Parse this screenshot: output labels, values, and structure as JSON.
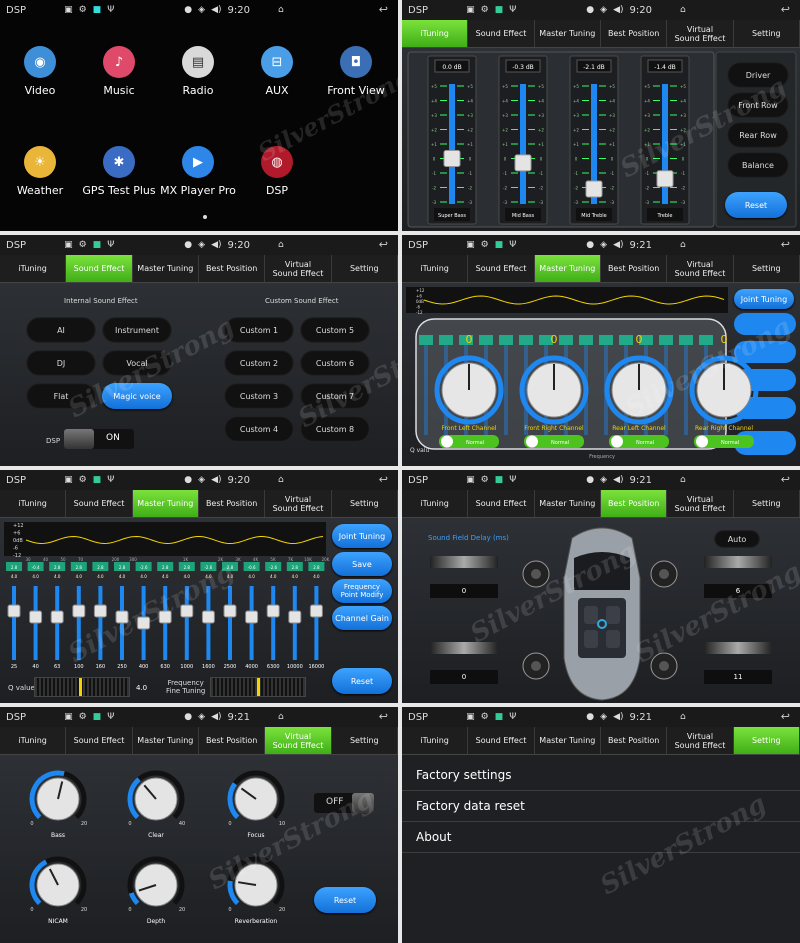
{
  "status": {
    "app": "DSP",
    "time_a": "9:20",
    "time_b": "9:21"
  },
  "watermark": "SilverStrong",
  "tabs": [
    "iTuning",
    "Sound Effect",
    "Master Tuning",
    "Best Position",
    "Virtual\nSound Effect",
    "Setting"
  ],
  "home": {
    "apps": [
      {
        "label": "Video",
        "icon": "video-icon",
        "color": "#3f8fd8"
      },
      {
        "label": "Music",
        "icon": "music-icon",
        "color": "#e04a6a"
      },
      {
        "label": "Radio",
        "icon": "radio-icon",
        "color": "#d9d9d9"
      },
      {
        "label": "AUX",
        "icon": "aux-icon",
        "color": "#4a9ee8"
      },
      {
        "label": "Front View",
        "icon": "camera-icon",
        "color": "#3a6fb5"
      },
      {
        "label": "Weather",
        "icon": "weather-icon",
        "color": "#e9b63a"
      },
      {
        "label": "GPS Test Plus",
        "icon": "gps-icon",
        "color": "#3b6cc4"
      },
      {
        "label": "MX Player Pro",
        "icon": "play-icon",
        "color": "#2d86e8"
      },
      {
        "label": "DSP",
        "icon": "dsp-icon",
        "color": "#b01a2a"
      }
    ]
  },
  "ituning": {
    "sliders": [
      {
        "name": "Super Bass",
        "value": "0.0 dB",
        "level": 0.0
      },
      {
        "name": "Mid Bass",
        "value": "-0.3 dB",
        "level": -0.3
      },
      {
        "name": "Mid Treble",
        "value": "-2.1 dB",
        "level": -2.1
      },
      {
        "name": "Treble",
        "value": "-1.4 dB",
        "level": -1.4
      }
    ],
    "scale": [
      "+5",
      "+4",
      "+3",
      "+2",
      "+1",
      "0",
      "-1",
      "-2",
      "-3"
    ],
    "buttons": [
      "Driver",
      "Front Row",
      "Rear Row",
      "Balance"
    ],
    "reset": "Reset"
  },
  "sound_effect": {
    "internal_title": "Internal Sound Effect",
    "custom_title": "Custom Sound Effect",
    "internal": [
      "AI",
      "Instrument",
      "DJ",
      "Vocal",
      "Flat",
      "Magic voice"
    ],
    "selected": "Magic voice",
    "custom": [
      "Custom 1",
      "Custom 5",
      "Custom 2",
      "Custom 6",
      "Custom 3",
      "Custom 7",
      "Custom 4",
      "Custom 8"
    ],
    "dsp_label": "DSP",
    "dsp_state": "ON"
  },
  "master_joint": {
    "channels": [
      "Front Left Channel",
      "Front Right Channel",
      "Rear Left Channel",
      "Rear Right Channel"
    ],
    "value": "0",
    "mode": "Normal",
    "joint": "Joint Tuning",
    "q": "Q valu",
    "freq": "Frequency\nFine Tuning"
  },
  "master_tuning": {
    "db_scale": [
      "+12",
      "+6",
      "0dB",
      "-6",
      "-12"
    ],
    "bands": [
      "25",
      "40",
      "63",
      "100",
      "160",
      "250",
      "400",
      "630",
      "1000",
      "1600",
      "2500",
      "4000",
      "6300",
      "10000",
      "16000"
    ],
    "top_freqs": [
      "30",
      "40",
      "50",
      "70",
      "",
      "200",
      "300",
      "",
      "",
      "1K",
      "",
      "2K",
      "3K",
      "4K",
      "5K",
      "7K",
      "10K",
      "20K"
    ],
    "gain": [
      "2.8",
      "-0.4",
      "2.8",
      "2.8",
      "2.8",
      "2.8",
      "-2.6",
      "2.8",
      "2.8",
      "-2.6",
      "2.8",
      "-0.6",
      "-2.6",
      "2.8",
      "2.8"
    ],
    "q": [
      "4.0",
      "4.0",
      "4.0",
      "4.0",
      "4.0",
      "4.0",
      "4.0",
      "4.0",
      "4.0",
      "4.0",
      "4.0",
      "4.0",
      "4.0",
      "4.0",
      "4.0"
    ],
    "levels": [
      0.2,
      0.1,
      0.1,
      0.2,
      0.2,
      0.1,
      0.0,
      0.1,
      0.2,
      0.1,
      0.2,
      0.1,
      0.2,
      0.1,
      0.2
    ],
    "buttons": [
      "Joint Tuning",
      "Save",
      "Frequency\nPoint Modify",
      "Channel Gain"
    ],
    "q_label": "Q value",
    "q_value": "4.0",
    "freq_label": "Frequency\nFine Tuning",
    "reset": "Reset"
  },
  "best_position": {
    "title": "Sound Field Delay (ms)",
    "auto": "Auto",
    "delays": {
      "front_left": "0",
      "front_right": "6",
      "rear_left": "0",
      "rear_right": "11"
    }
  },
  "virtual": {
    "knobs": [
      {
        "name": "Bass",
        "min": "0",
        "max": "20",
        "value": 0.55
      },
      {
        "name": "Clear",
        "min": "0",
        "max": "40",
        "value": 0.35
      },
      {
        "name": "Focus",
        "min": "0",
        "max": "10",
        "value": 0.3
      },
      {
        "name": "NICAM",
        "min": "0",
        "max": "20",
        "value": 0.4
      },
      {
        "name": "Depth",
        "min": "0",
        "max": "20",
        "value": 0.1
      },
      {
        "name": "Reverberation",
        "min": "0",
        "max": "20",
        "value": 0.2
      }
    ],
    "toggle": "OFF",
    "reset": "Reset"
  },
  "setting": {
    "items": [
      "Factory settings",
      "Factory data reset",
      "About"
    ]
  },
  "colors": {
    "accent_green": "#4cc31f",
    "accent_blue": "#1e88f0",
    "tuning_yellow": "#f2d400"
  }
}
